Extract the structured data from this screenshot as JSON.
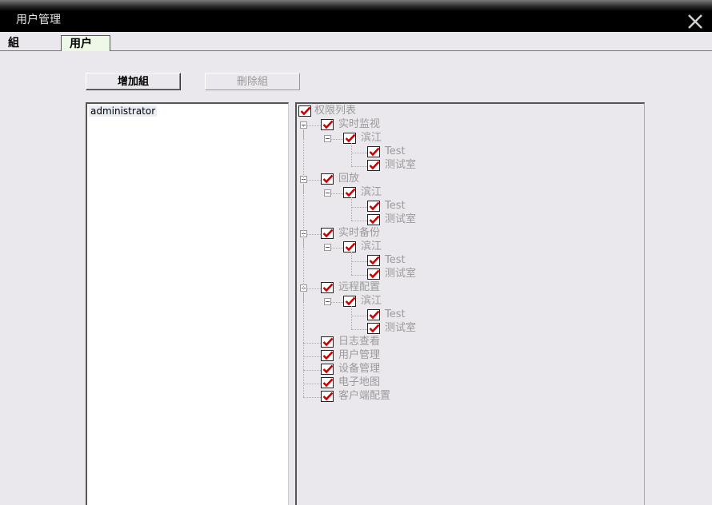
{
  "window": {
    "title": "用户管理"
  },
  "tabs": [
    {
      "label": "組"
    },
    {
      "label": "用户"
    }
  ],
  "buttons": {
    "add_group": "增加組",
    "delete_group": "刪除組"
  },
  "groups": [
    "administrator"
  ],
  "permissions": {
    "root": "权限列表",
    "sections": [
      {
        "label": "实时监视",
        "children": [
          {
            "label": "滨江",
            "children": [
              "Test",
              "测试室"
            ]
          }
        ]
      },
      {
        "label": "回放",
        "children": [
          {
            "label": "滨江",
            "children": [
              "Test",
              "测试室"
            ]
          }
        ]
      },
      {
        "label": "实时备份",
        "children": [
          {
            "label": "滨江",
            "children": [
              "Test",
              "测试室"
            ]
          }
        ]
      },
      {
        "label": "远程配置",
        "children": [
          {
            "label": "滨江",
            "children": [
              "Test",
              "测试室"
            ]
          }
        ]
      }
    ],
    "leaves": [
      "日志查看",
      "用户管理",
      "设备管理",
      "电子地图",
      "客户端配置"
    ]
  },
  "colors": {
    "check": "#cc0000",
    "disabled_text": "#9a9a9a",
    "active_tab_bg": "#edf8e6"
  }
}
